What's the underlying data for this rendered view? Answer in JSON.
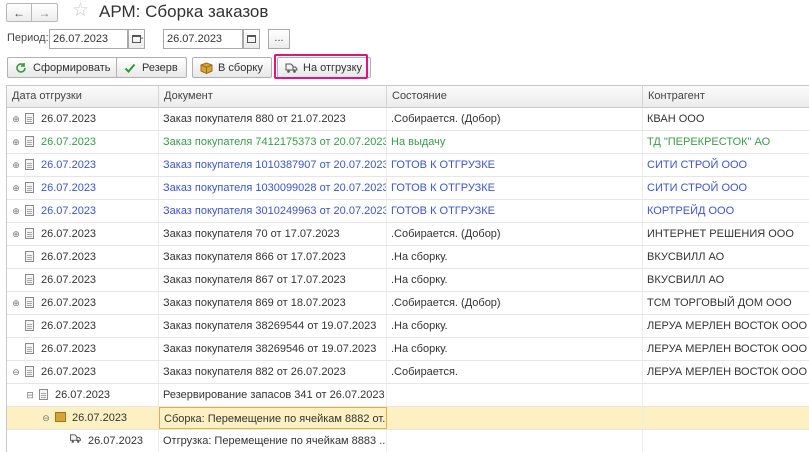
{
  "window": {
    "title": "АРМ: Сборка заказов",
    "back_glyph": "←",
    "forward_glyph": "→",
    "favorite_glyph": "☆"
  },
  "period": {
    "label": "Период:",
    "from": "26.07.2023",
    "to": "26.07.2023",
    "separator": "-",
    "more": "..."
  },
  "toolbar": {
    "generate": "Сформировать",
    "reserve": "Резерв",
    "to_assembly": "В сборку",
    "to_shipment": "На отгрузку"
  },
  "colors": {
    "highlight_frame": "#e0147a",
    "green_text": "#3c9a4b",
    "blue_text": "#3b56c8",
    "selected_row": "#fdf1c3"
  },
  "table": {
    "columns": [
      "Дата отгрузки",
      "Документ",
      "Состояние",
      "Контрагент"
    ],
    "rows": [
      {
        "date": "26.07.2023",
        "doc": "Заказ покупателя 880 от 21.07.2023",
        "state": ".Собирается. (Добор)",
        "ctr": "КВАН ООО"
      },
      {
        "date": "26.07.2023",
        "doc": "Заказ покупателя 7412175373 от 20.07.2023",
        "state": "На выдачу",
        "ctr": "ТД \"ПЕРЕКРЕСТОК\" АО"
      },
      {
        "date": "26.07.2023",
        "doc": "Заказ покупателя 1010387907 от 20.07.2023",
        "state": "ГОТОВ К ОТГРУЗКЕ",
        "ctr": "СИТИ СТРОЙ ООО"
      },
      {
        "date": "26.07.2023",
        "doc": "Заказ покупателя 1030099028 от 20.07.2023",
        "state": "ГОТОВ К ОТГРУЗКЕ",
        "ctr": "СИТИ СТРОЙ ООО"
      },
      {
        "date": "26.07.2023",
        "doc": "Заказ покупателя 3010249963 от 20.07.2023",
        "state": "ГОТОВ К ОТГРУЗКЕ",
        "ctr": "КОРТРЕЙД ООО"
      },
      {
        "date": "26.07.2023",
        "doc": "Заказ покупателя 70 от 17.07.2023",
        "state": ".Собирается. (Добор)",
        "ctr": "ИНТЕРНЕТ РЕШЕНИЯ ООО"
      },
      {
        "date": "26.07.2023",
        "doc": "Заказ покупателя 866 от 17.07.2023",
        "state": ".На сборку.",
        "ctr": "ВКУСВИЛЛ АО"
      },
      {
        "date": "26.07.2023",
        "doc": "Заказ покупателя 867 от 17.07.2023",
        "state": ".На сборку.",
        "ctr": "ВКУСВИЛЛ АО"
      },
      {
        "date": "26.07.2023",
        "doc": "Заказ покупателя 869 от 18.07.2023",
        "state": ".Собирается. (Добор)",
        "ctr": "ТСМ ТОРГОВЫЙ ДОМ ООО"
      },
      {
        "date": "26.07.2023",
        "doc": "Заказ покупателя 38269544 от 19.07.2023",
        "state": ".На сборку.",
        "ctr": "ЛЕРУА МЕРЛЕН ВОСТОК ООО"
      },
      {
        "date": "26.07.2023",
        "doc": "Заказ покупателя 38269546 от 19.07.2023",
        "state": ".На сборку.",
        "ctr": "ЛЕРУА МЕРЛЕН ВОСТОК ООО"
      },
      {
        "date": "26.07.2023",
        "doc": "Заказ покупателя 882 от 26.07.2023",
        "state": ".Собирается.",
        "ctr": "ЛЕРУА МЕРЛЕН ВОСТОК ООО"
      },
      {
        "date": "26.07.2023",
        "doc": "Резервирование запасов 341 от 26.07.2023",
        "state": "",
        "ctr": ""
      },
      {
        "date": "26.07.2023",
        "doc": "Сборка: Перемещение по ячейкам 8882 от...",
        "state": "",
        "ctr": ""
      },
      {
        "date": "26.07.2023",
        "doc": "Отгрузка: Перемещение по ячейкам 8883 ...",
        "state": "",
        "ctr": ""
      }
    ]
  }
}
